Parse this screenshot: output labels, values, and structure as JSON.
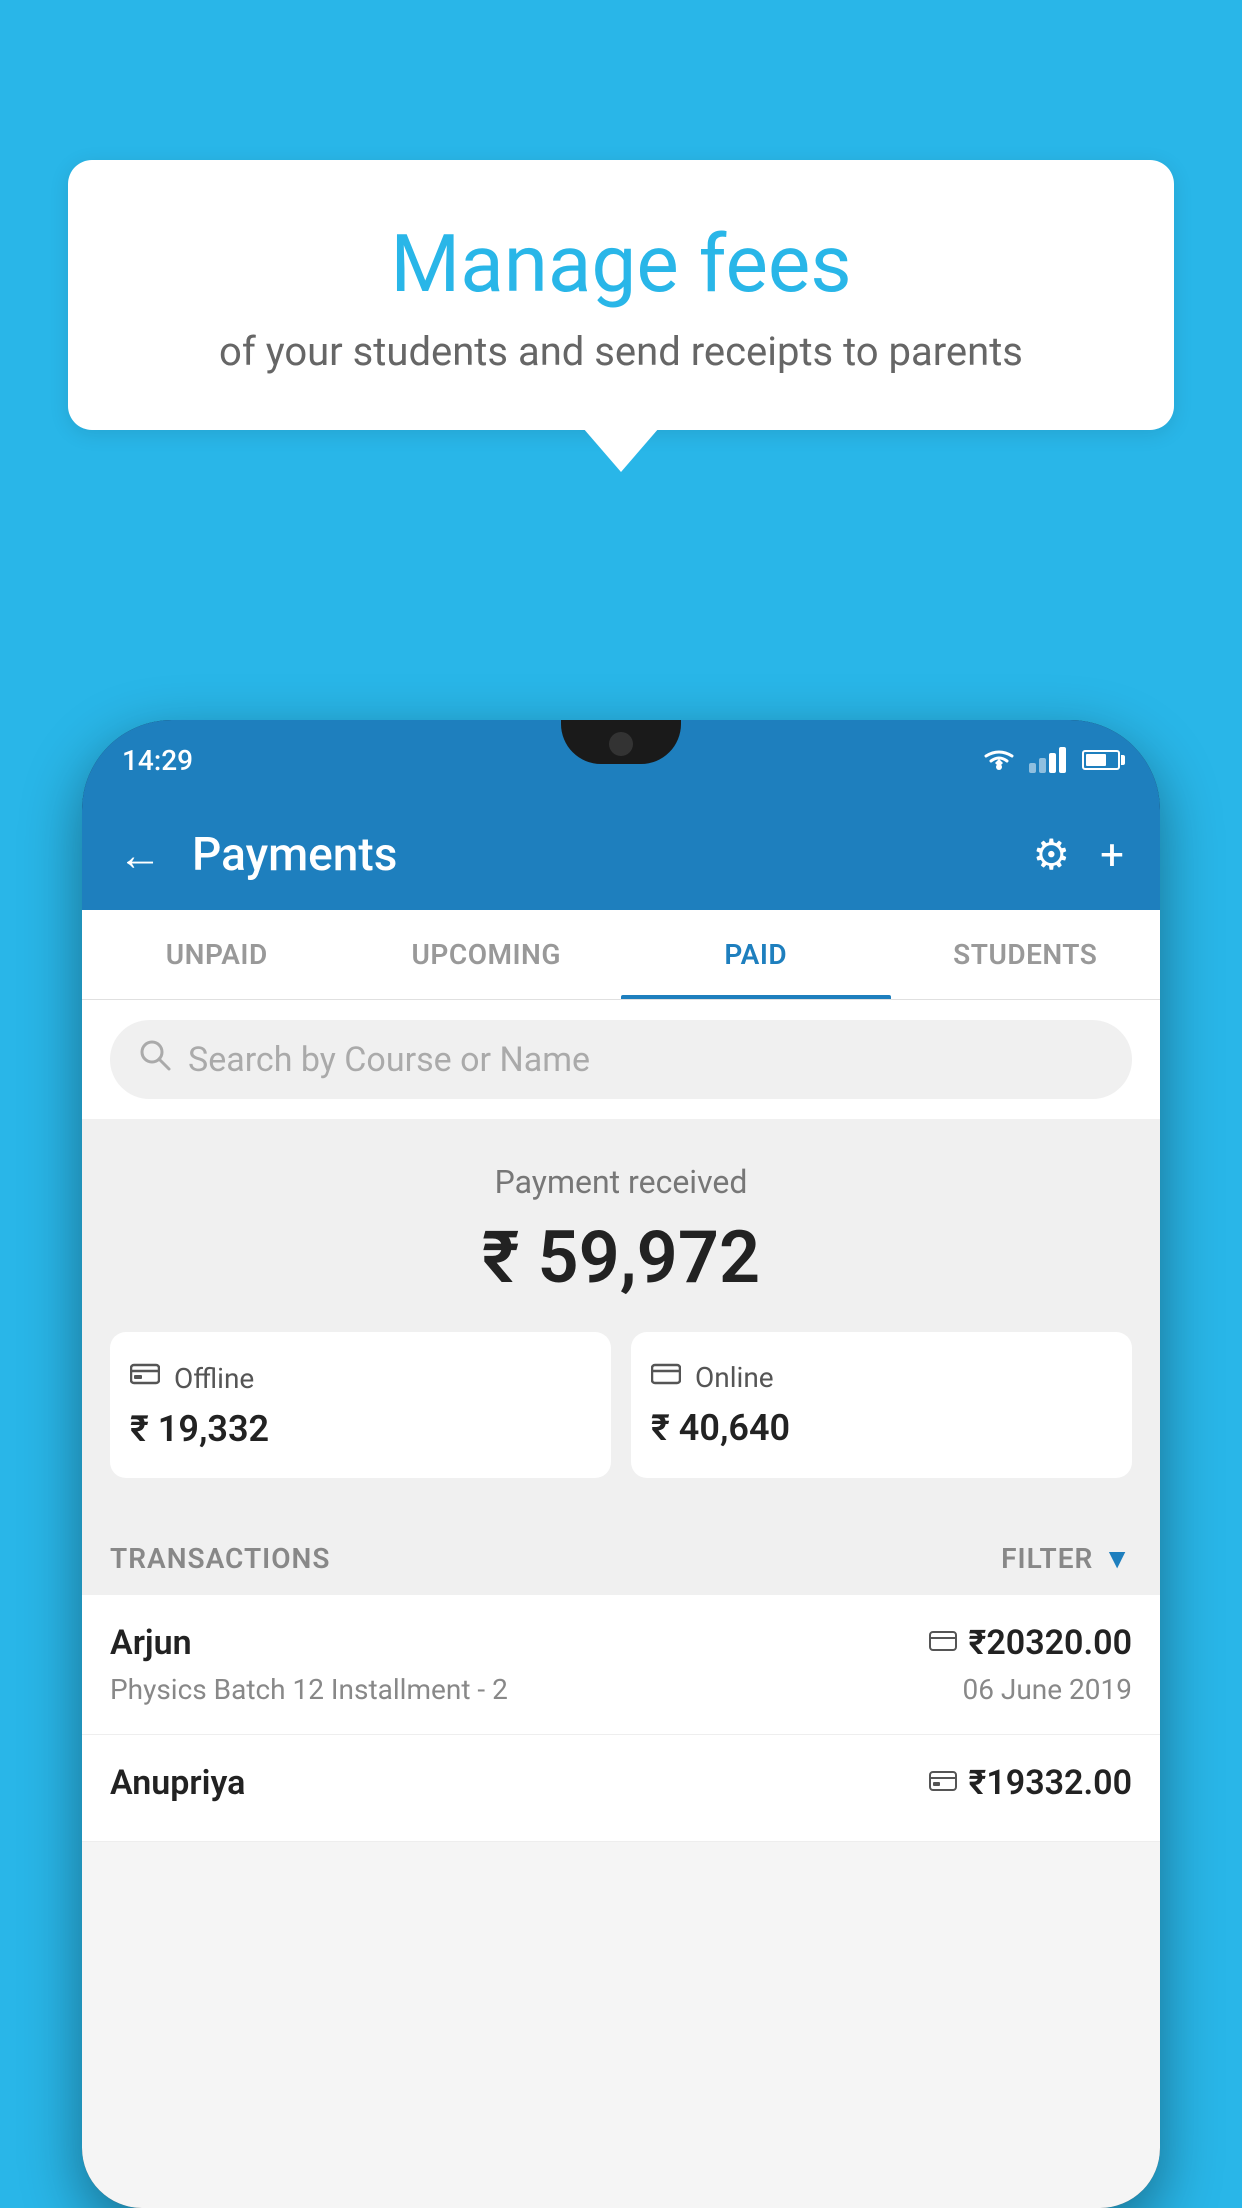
{
  "background_color": "#29b6e8",
  "bubble": {
    "title": "Manage fees",
    "subtitle": "of your students and send receipts to parents"
  },
  "phone": {
    "status_bar": {
      "time": "14:29"
    },
    "header": {
      "back_label": "←",
      "title": "Payments",
      "settings_icon": "⚙",
      "add_icon": "+"
    },
    "tabs": [
      {
        "id": "unpaid",
        "label": "UNPAID",
        "active": false
      },
      {
        "id": "upcoming",
        "label": "UPCOMING",
        "active": false
      },
      {
        "id": "paid",
        "label": "PAID",
        "active": true
      },
      {
        "id": "students",
        "label": "STUDENTS",
        "active": false
      }
    ],
    "search": {
      "placeholder": "Search by Course or Name"
    },
    "payment_summary": {
      "label": "Payment received",
      "amount": "₹ 59,972",
      "offline": {
        "icon": "💳",
        "label": "Offline",
        "amount": "₹ 19,332"
      },
      "online": {
        "icon": "💳",
        "label": "Online",
        "amount": "₹ 40,640"
      }
    },
    "transactions": {
      "section_label": "TRANSACTIONS",
      "filter_label": "FILTER",
      "items": [
        {
          "name": "Arjun",
          "description": "Physics Batch 12 Installment - 2",
          "amount": "₹20320.00",
          "date": "06 June 2019",
          "payment_type": "online"
        },
        {
          "name": "Anupriya",
          "description": "",
          "amount": "₹19332.00",
          "date": "",
          "payment_type": "offline"
        }
      ]
    }
  }
}
